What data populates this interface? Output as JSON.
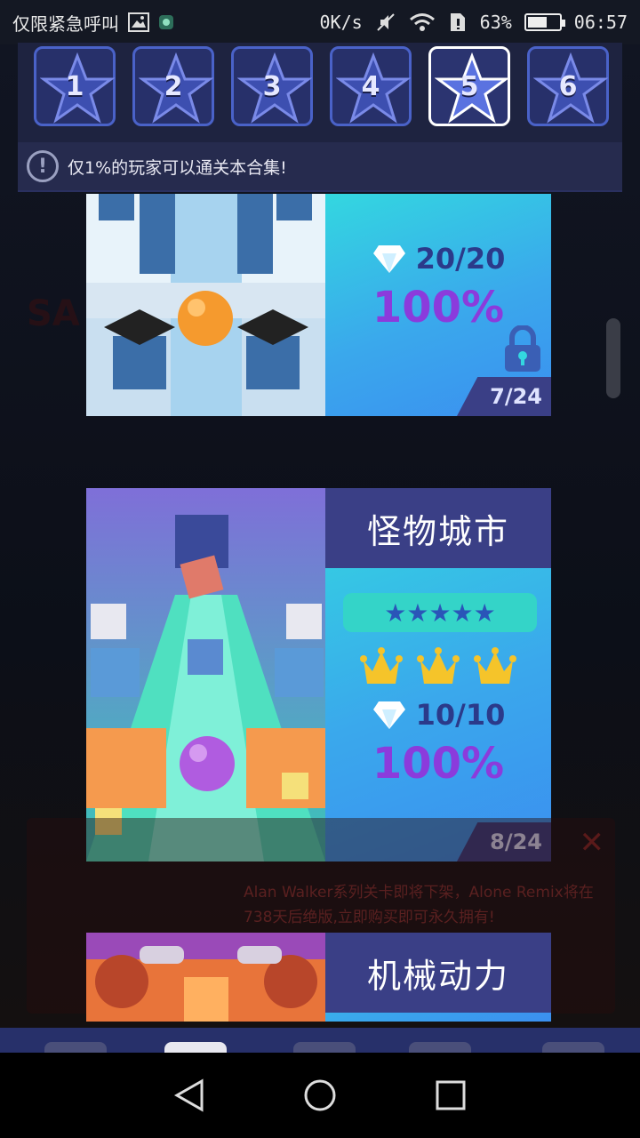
{
  "status_bar": {
    "carrier": "仅限紧急呼叫",
    "speed": "0K/s",
    "battery": "63%",
    "battery_level": 0.63,
    "time": "06:57"
  },
  "star_tabs": [
    {
      "label": "1",
      "active": false
    },
    {
      "label": "2",
      "active": false
    },
    {
      "label": "3",
      "active": false
    },
    {
      "label": "4",
      "active": false
    },
    {
      "label": "5",
      "active": true
    },
    {
      "label": "6",
      "active": false
    }
  ],
  "notice": {
    "icon": "!",
    "text": "仅1%的玩家可以通关本合集!"
  },
  "levels": [
    {
      "gems": "20/20",
      "percent": "100%",
      "progress": "7/24",
      "locked": true
    },
    {
      "title": "怪物城市",
      "stars": "★★★★★",
      "crowns": 3,
      "gems": "10/10",
      "percent": "100%",
      "progress": "8/24"
    },
    {
      "title": "机械动力"
    }
  ],
  "toast": {
    "close": "✕",
    "text": "Alan Walker系列关卡即将下架，Alone Remix将在738天后绝版,立即购买即可永久拥有!"
  },
  "colors": {
    "panel": "#1e2340",
    "band": "#3a3f86",
    "percent": "#8b3bdc",
    "accent_border": "#4a62c8"
  }
}
